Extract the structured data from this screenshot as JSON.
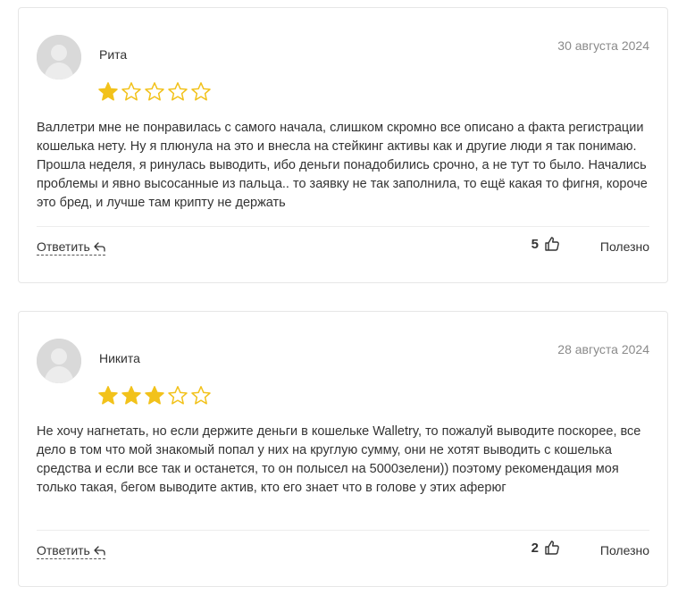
{
  "reviews": [
    {
      "author": "Рита",
      "date": "30 августа 2024",
      "rating": 1,
      "max_rating": 5,
      "text": "Валлетри мне не понравилась с самого начала, слишком скромно все описано а факта регистрации кошелька нету. Ну я плюнула на это и внесла на стейкинг активы как и другие люди я так понимаю. Прошла неделя, я ринулась выводить, ибо деньги понадобились срочно, а не тут то было. Начались проблемы и явно высосанные из пальца.. то заявку не так заполнила, то ещё какая то фигня, короче это бред, и лучше там крипту не держать",
      "reply_label": "Ответить",
      "likes": "5",
      "useful_label": "Полезно"
    },
    {
      "author": "Никита",
      "date": "28 августа 2024",
      "rating": 3,
      "max_rating": 5,
      "text": "Не хочу нагнетать, но если держите деньги в кошельке Walletry, то пожалуй выводите поскорее, все дело в том что мой знакомый попал у них на круглую сумму, они не хотят выводить с кошелька средства и если все так и останется, то он полысел на 5000зелени)) поэтому рекомендация моя только такая, бегом выводите актив, кто его знает что в голове у этих аферюг",
      "reply_label": "Ответить",
      "likes": "2",
      "useful_label": "Полезно"
    }
  ],
  "colors": {
    "star_fill": "#f2c21b",
    "star_empty": "#f2c21b",
    "avatar_bg": "#d9d9d9",
    "date": "#8a8a8a"
  },
  "icons": {
    "avatar": "user-silhouette-icon",
    "star_filled": "star-filled-icon",
    "star_empty": "star-outline-icon",
    "reply": "reply-arrow-icon",
    "like": "thumbs-up-icon"
  }
}
